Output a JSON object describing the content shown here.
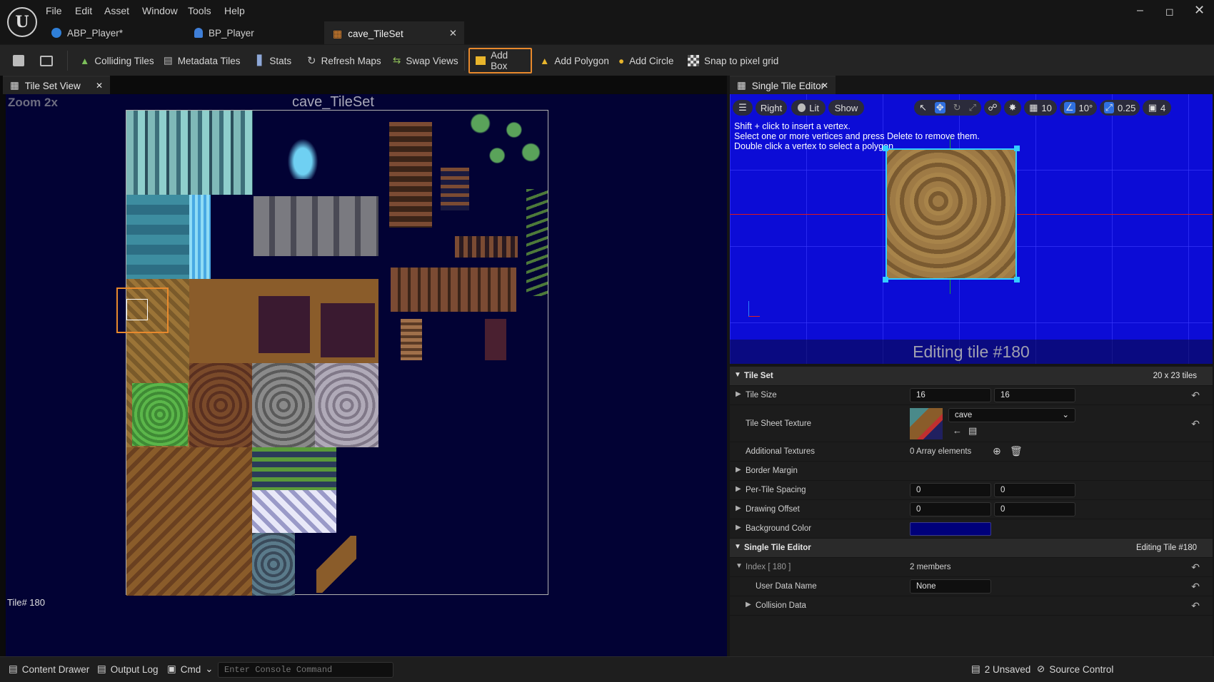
{
  "menu": {
    "file": "File",
    "edit": "Edit",
    "asset": "Asset",
    "window": "Window",
    "tools": "Tools",
    "help": "Help"
  },
  "tabs": {
    "abp": "ABP_Player*",
    "bp": "BP_Player",
    "cave": "cave_TileSet"
  },
  "toolbar": {
    "colliding": "Colliding Tiles",
    "metadata": "Metadata Tiles",
    "stats": "Stats",
    "refresh": "Refresh Maps",
    "swap": "Swap Views",
    "add_box": "Add Box",
    "add_polygon": "Add Polygon",
    "add_circle": "Add Circle",
    "snap": "Snap to pixel grid"
  },
  "tileset_view": {
    "tab": "Tile Set View",
    "zoom": "Zoom 2x",
    "title": "cave_TileSet",
    "tile_index": "Tile# 180"
  },
  "single_tile": {
    "tab": "Single Tile Editor",
    "view": "Right",
    "lit": "Lit",
    "show": "Show",
    "grid": "10",
    "angle": "10°",
    "scale": "0.25",
    "camera": "4",
    "help1": "Shift + click to insert a vertex.",
    "help2": "Select one or more vertices and press Delete to remove them.",
    "help3": "Double click a vertex to select a polygon",
    "editing": "Editing tile #180"
  },
  "details": {
    "tile_set": "Tile Set",
    "tile_set_dims": "20 x 23 tiles",
    "tile_size": "Tile Size",
    "tile_size_x": "16",
    "tile_size_y": "16",
    "tile_sheet_texture": "Tile Sheet Texture",
    "texture": "cave",
    "additional_textures": "Additional Textures",
    "array_elements": "0 Array elements",
    "border_margin": "Border Margin",
    "per_tile_spacing": "Per-Tile Spacing",
    "spacing_x": "0",
    "spacing_y": "0",
    "drawing_offset": "Drawing Offset",
    "offset_x": "0",
    "offset_y": "0",
    "background_color": "Background Color",
    "bg_color_hex": "#00007a",
    "single_tile_editor": "Single Tile Editor",
    "editing_tile": "Editing Tile #180",
    "index": "Index [ 180 ]",
    "members": "2 members",
    "user_data_name": "User Data Name",
    "user_data_value": "None",
    "collision_data": "Collision Data"
  },
  "statusbar": {
    "content_drawer": "Content Drawer",
    "output_log": "Output Log",
    "cmd": "Cmd",
    "console_placeholder": "Enter Console Command",
    "unsaved": "2 Unsaved",
    "source_control": "Source Control"
  },
  "colors": {
    "accent": "#e8892c",
    "viewport": "#0c0cd6",
    "tileset_bg": "#020234"
  }
}
